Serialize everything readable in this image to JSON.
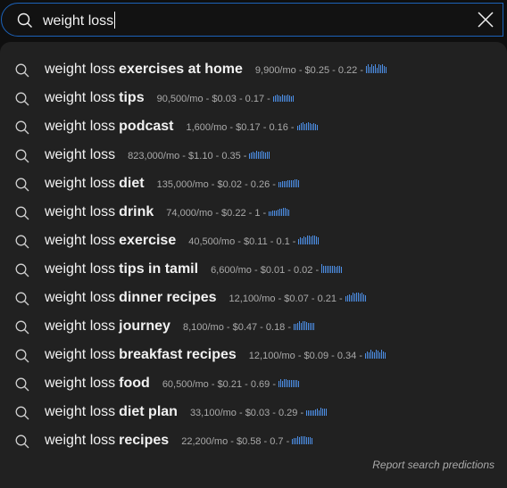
{
  "search": {
    "query": "weight loss",
    "icon": "search-icon",
    "clear_icon": "close-icon"
  },
  "colors": {
    "accent": "#1c62b9",
    "trend_bar": "#4d8fe6",
    "background": "#0f0f0f",
    "dropdown": "#212121"
  },
  "suggestions": [
    {
      "prefix": "weight loss",
      "suffix": "exercises at home",
      "meta": "9,900/mo - $0.25 - 0.22 -",
      "trend": [
        8,
        10,
        7,
        10,
        8,
        10,
        6,
        10,
        9,
        10,
        8,
        7
      ]
    },
    {
      "prefix": "weight loss",
      "suffix": "tips",
      "meta": "90,500/mo - $0.03 - 0.17 -",
      "trend": [
        6,
        7,
        8,
        7,
        6,
        8,
        7,
        7,
        8,
        7,
        6,
        7
      ]
    },
    {
      "prefix": "weight loss",
      "suffix": "podcast",
      "meta": "1,600/mo - $0.17 - 0.16 -",
      "trend": [
        5,
        6,
        8,
        9,
        7,
        8,
        9,
        8,
        7,
        8,
        7,
        6
      ]
    },
    {
      "prefix": "weight loss",
      "suffix": "",
      "meta": "823,000/mo - $1.10 - 0.35 -",
      "trend": [
        6,
        7,
        8,
        7,
        9,
        8,
        8,
        9,
        8,
        7,
        8,
        8
      ]
    },
    {
      "prefix": "weight loss",
      "suffix": "diet",
      "meta": "135,000/mo - $0.02 - 0.26 -",
      "trend": [
        6,
        6,
        7,
        7,
        7,
        8,
        8,
        8,
        8,
        9,
        9,
        8
      ]
    },
    {
      "prefix": "weight loss",
      "suffix": "drink",
      "meta": "74,000/mo - $0.22 - 1 -",
      "trend": [
        5,
        5,
        6,
        6,
        6,
        7,
        8,
        8,
        9,
        9,
        8,
        7
      ]
    },
    {
      "prefix": "weight loss",
      "suffix": "exercise",
      "meta": "40,500/mo - $0.11 - 0.1 -",
      "trend": [
        6,
        8,
        7,
        9,
        8,
        10,
        10,
        9,
        10,
        10,
        9,
        8
      ]
    },
    {
      "prefix": "weight loss",
      "suffix": "tips in tamil",
      "meta": "6,600/mo - $0.01 - 0.02 -",
      "trend": [
        10,
        8,
        8,
        8,
        8,
        8,
        8,
        8,
        7,
        8,
        8,
        7
      ]
    },
    {
      "prefix": "weight loss",
      "suffix": "dinner recipes",
      "meta": "12,100/mo - $0.07 - 0.21 -",
      "trend": [
        6,
        7,
        8,
        7,
        10,
        9,
        10,
        10,
        9,
        10,
        8,
        7
      ]
    },
    {
      "prefix": "weight loss",
      "suffix": "journey",
      "meta": "8,100/mo - $0.47 - 0.18 -",
      "trend": [
        7,
        7,
        8,
        10,
        8,
        10,
        10,
        9,
        8,
        8,
        8,
        8
      ]
    },
    {
      "prefix": "weight loss",
      "suffix": "breakfast recipes",
      "meta": "12,100/mo - $0.09 - 0.34 -",
      "trend": [
        6,
        8,
        7,
        10,
        8,
        7,
        10,
        9,
        7,
        10,
        8,
        7
      ]
    },
    {
      "prefix": "weight loss",
      "suffix": "food",
      "meta": "60,500/mo - $0.21 - 0.69 -",
      "trend": [
        7,
        9,
        7,
        9,
        9,
        8,
        8,
        8,
        8,
        8,
        8,
        7
      ]
    },
    {
      "prefix": "weight loss",
      "suffix": "diet plan",
      "meta": "33,100/mo - $0.03 - 0.29 -",
      "trend": [
        6,
        6,
        6,
        6,
        6,
        7,
        8,
        6,
        9,
        8,
        8,
        8
      ]
    },
    {
      "prefix": "weight loss",
      "suffix": "recipes",
      "meta": "22,200/mo - $0.58 - 0.7 -",
      "trend": [
        6,
        7,
        7,
        9,
        8,
        9,
        9,
        9,
        8,
        8,
        8,
        7
      ]
    }
  ],
  "footer": {
    "report_label": "Report search predictions"
  }
}
